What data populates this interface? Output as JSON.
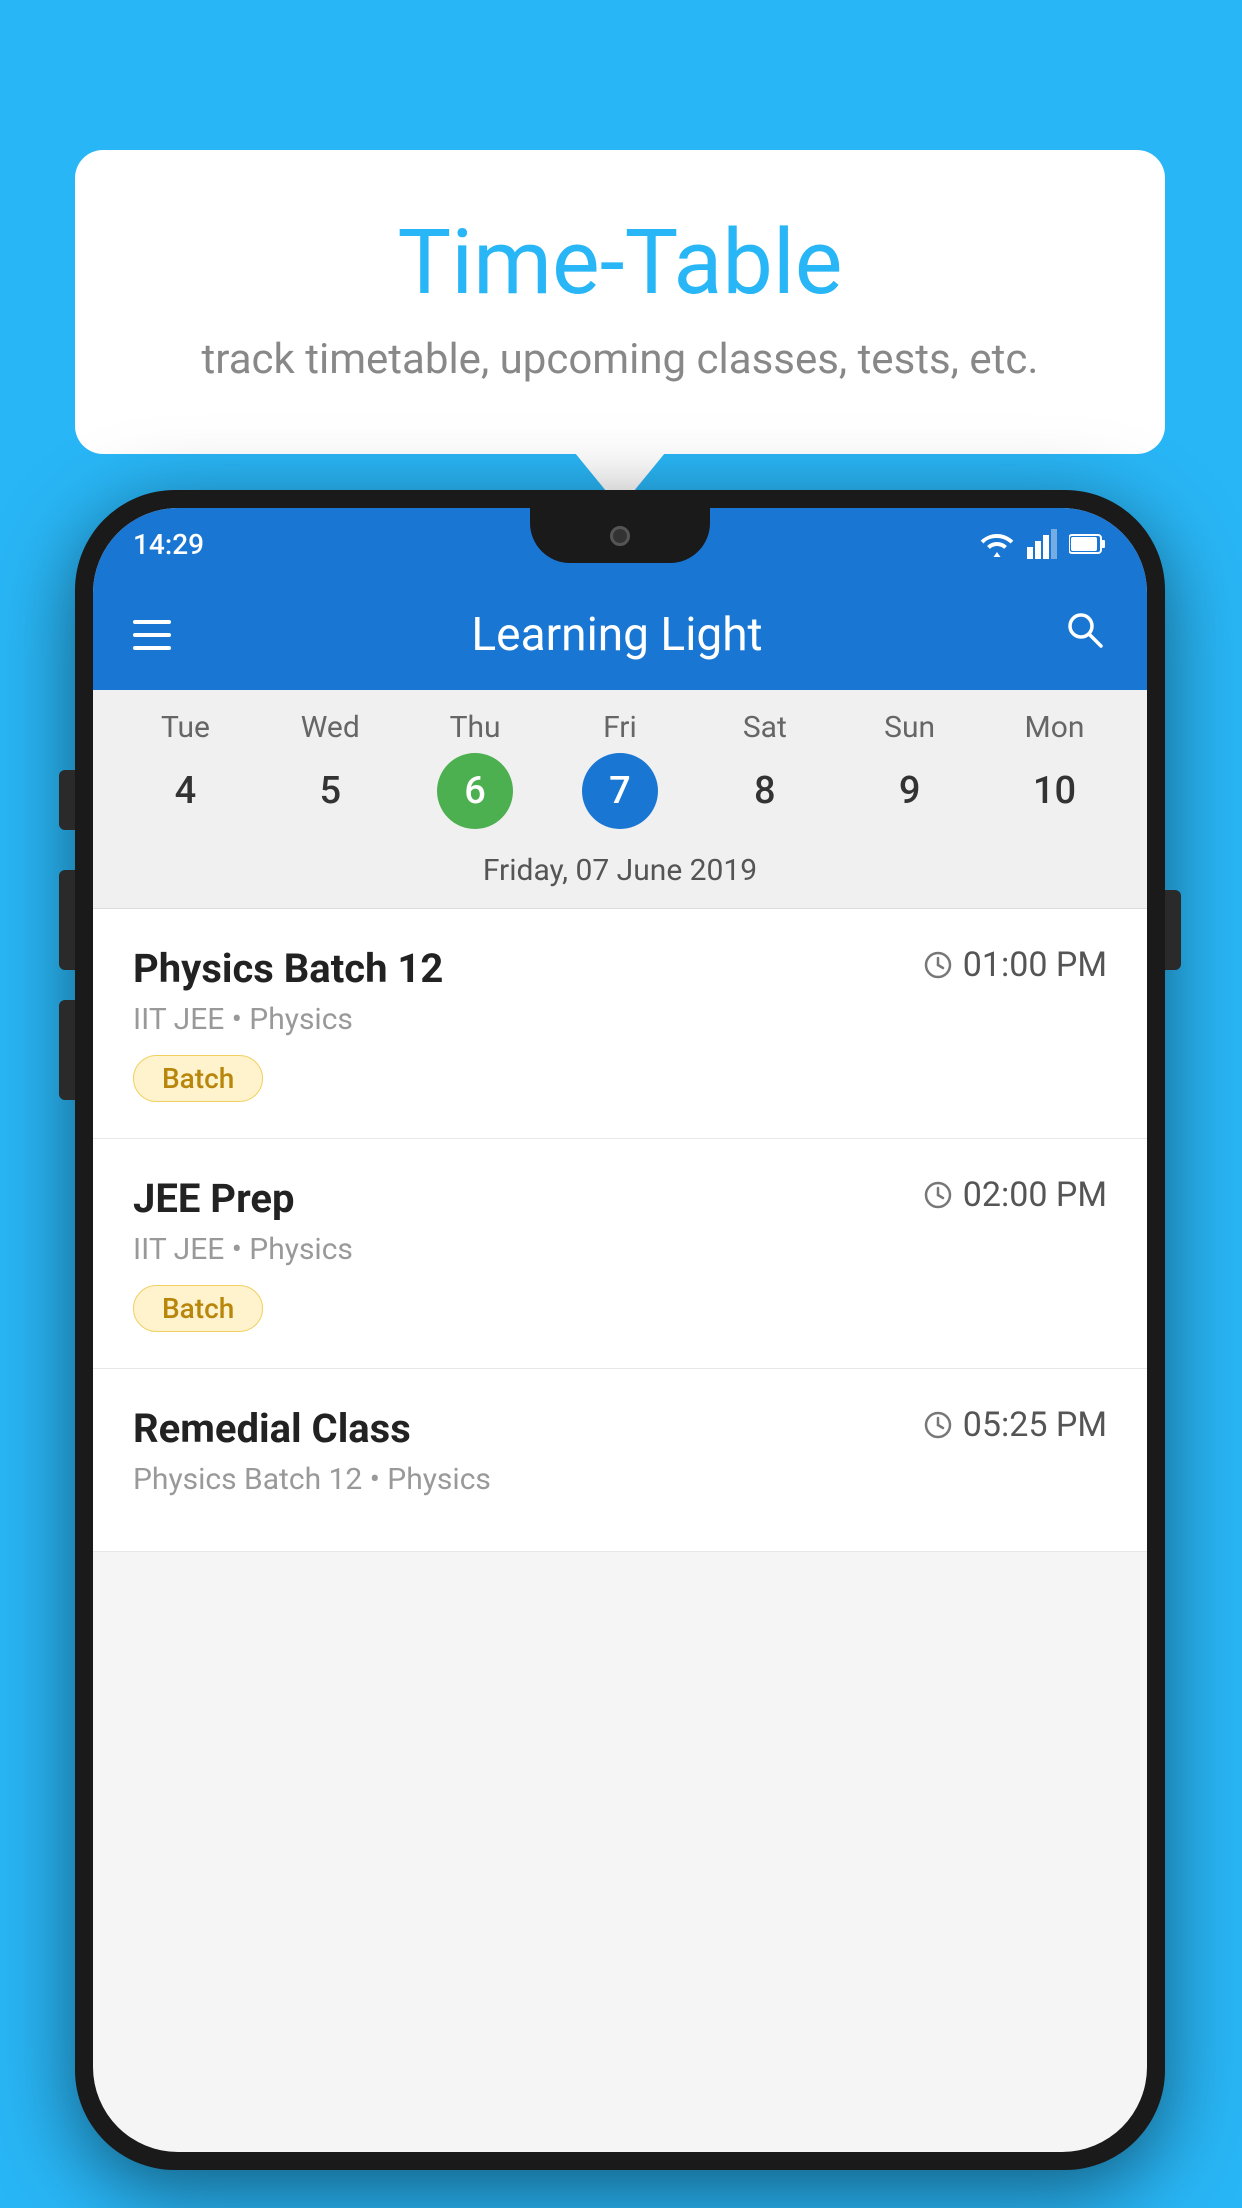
{
  "background_color": "#29b6f6",
  "tooltip": {
    "title": "Time-Table",
    "subtitle": "track timetable, upcoming classes, tests, etc."
  },
  "phone": {
    "status_bar": {
      "time": "14:29"
    },
    "app_bar": {
      "title": "Learning Light"
    },
    "calendar": {
      "days": [
        {
          "name": "Tue",
          "num": "4",
          "state": "normal"
        },
        {
          "name": "Wed",
          "num": "5",
          "state": "normal"
        },
        {
          "name": "Thu",
          "num": "6",
          "state": "today"
        },
        {
          "name": "Fri",
          "num": "7",
          "state": "selected"
        },
        {
          "name": "Sat",
          "num": "8",
          "state": "normal"
        },
        {
          "name": "Sun",
          "num": "9",
          "state": "normal"
        },
        {
          "name": "Mon",
          "num": "10",
          "state": "normal"
        }
      ],
      "selected_date_label": "Friday, 07 June 2019"
    },
    "classes": [
      {
        "name": "Physics Batch 12",
        "time": "01:00 PM",
        "meta": "IIT JEE • Physics",
        "badge": "Batch"
      },
      {
        "name": "JEE Prep",
        "time": "02:00 PM",
        "meta": "IIT JEE • Physics",
        "badge": "Batch"
      },
      {
        "name": "Remedial Class",
        "time": "05:25 PM",
        "meta": "Physics Batch 12 • Physics",
        "badge": null
      }
    ]
  },
  "icons": {
    "hamburger": "☰",
    "search": "🔍",
    "clock": "🕐"
  }
}
